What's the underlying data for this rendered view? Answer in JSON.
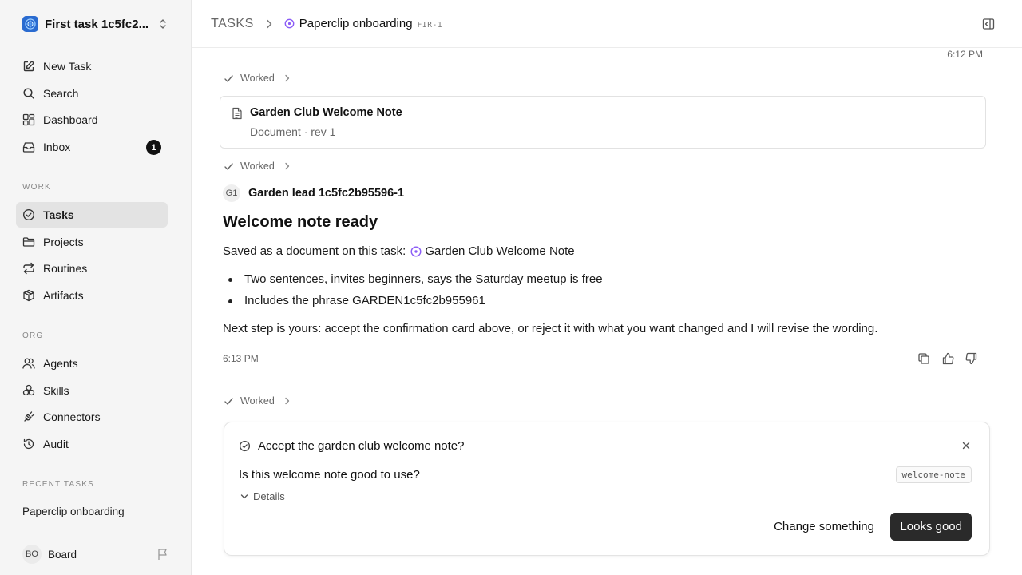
{
  "sidebar": {
    "workspace": {
      "name": "First task 1c5fc2..."
    },
    "top_items": [
      {
        "label": "New Task",
        "icon": "edit-icon"
      },
      {
        "label": "Search",
        "icon": "search-icon"
      },
      {
        "label": "Dashboard",
        "icon": "dashboard-icon"
      },
      {
        "label": "Inbox",
        "icon": "inbox-icon",
        "badge": "1"
      }
    ],
    "work_label": "WORK",
    "work_items": [
      {
        "label": "Tasks",
        "icon": "tasks-icon",
        "active": true
      },
      {
        "label": "Projects",
        "icon": "folder-icon"
      },
      {
        "label": "Routines",
        "icon": "repeat-icon"
      },
      {
        "label": "Artifacts",
        "icon": "box-icon"
      }
    ],
    "org_label": "ORG",
    "org_items": [
      {
        "label": "Agents",
        "icon": "users-icon"
      },
      {
        "label": "Skills",
        "icon": "skills-icon"
      },
      {
        "label": "Connectors",
        "icon": "plug-icon"
      },
      {
        "label": "Audit",
        "icon": "history-icon"
      }
    ],
    "recent_label": "RECENT TASKS",
    "recent_items": [
      {
        "label": "Paperclip onboarding"
      }
    ],
    "footer": {
      "initials": "BO",
      "name": "Board"
    }
  },
  "header": {
    "root": "TASKS",
    "title": "Paperclip onboarding",
    "id": "FIR-1",
    "status_color": "#8b5cf6"
  },
  "thread": {
    "timestamp_top": "6:12 PM",
    "worked_label": "Worked",
    "document": {
      "title": "Garden Club Welcome Note",
      "meta": "Document · rev 1"
    },
    "author": {
      "initials": "G1",
      "name": "Garden lead 1c5fc2b95596-1"
    },
    "message": {
      "title": "Welcome note ready",
      "saved_prefix": "Saved as a document on this task:",
      "saved_link": "Garden Club Welcome Note",
      "bullets": [
        "Two sentences, invites beginners, says the Saturday meetup is free",
        "Includes the phrase GARDEN1c5fc2b955961"
      ],
      "next_step": "Next step is yours: accept the confirmation card above, or reject it with what you want changed and I will revise the wording.",
      "timestamp": "6:13 PM"
    }
  },
  "confirmation": {
    "title": "Accept the garden club welcome note?",
    "question": "Is this welcome note good to use?",
    "tag": "welcome-note",
    "details_label": "Details",
    "reject_label": "Change something",
    "accept_label": "Looks good"
  }
}
